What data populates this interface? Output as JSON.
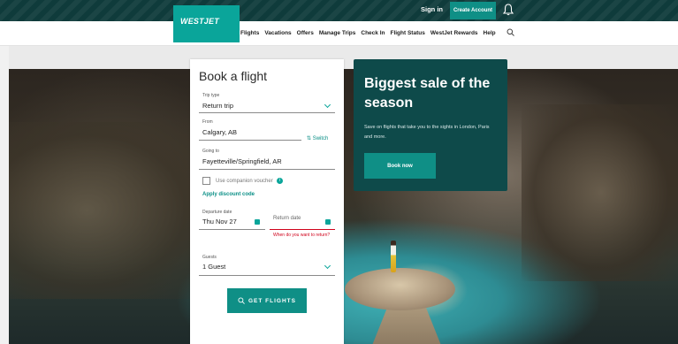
{
  "header": {
    "sign_in": "Sign in",
    "create_account": "Create Account",
    "logo": "WESTJET"
  },
  "nav": {
    "items": [
      "Flights",
      "Vacations",
      "Offers",
      "Manage Trips",
      "Check In",
      "Flight Status",
      "WestJet Rewards",
      "Help"
    ]
  },
  "booking": {
    "title": "Book a flight",
    "trip_type_label": "Trip type",
    "trip_type_value": "Return trip",
    "from_label": "From",
    "from_value": "Calgary, AB",
    "switch_label": "Switch",
    "going_to_label": "Going to",
    "going_to_value": "Fayetteville/Springfield, AR",
    "companion_voucher_label": "Use companion voucher",
    "discount_label": "Apply discount code",
    "departure_label": "Departure date",
    "departure_value": "Thu Nov 27",
    "return_label": "Return date",
    "return_error": "When do you want to return?",
    "guests_label": "Guests",
    "guests_value": "1 Guest",
    "get_flights": "GET FLIGHTS"
  },
  "promo": {
    "title": "Biggest sale of the season",
    "body": "Save on flights that take you to the sights in London, Paris and more.",
    "cta": "Book now"
  },
  "colors": {
    "brand_teal": "#0aa59a",
    "button_teal": "#0f8f86",
    "header_dark": "#0f3b3b",
    "promo_bg": "#0e4a4a",
    "error_red": "#d0021b"
  }
}
